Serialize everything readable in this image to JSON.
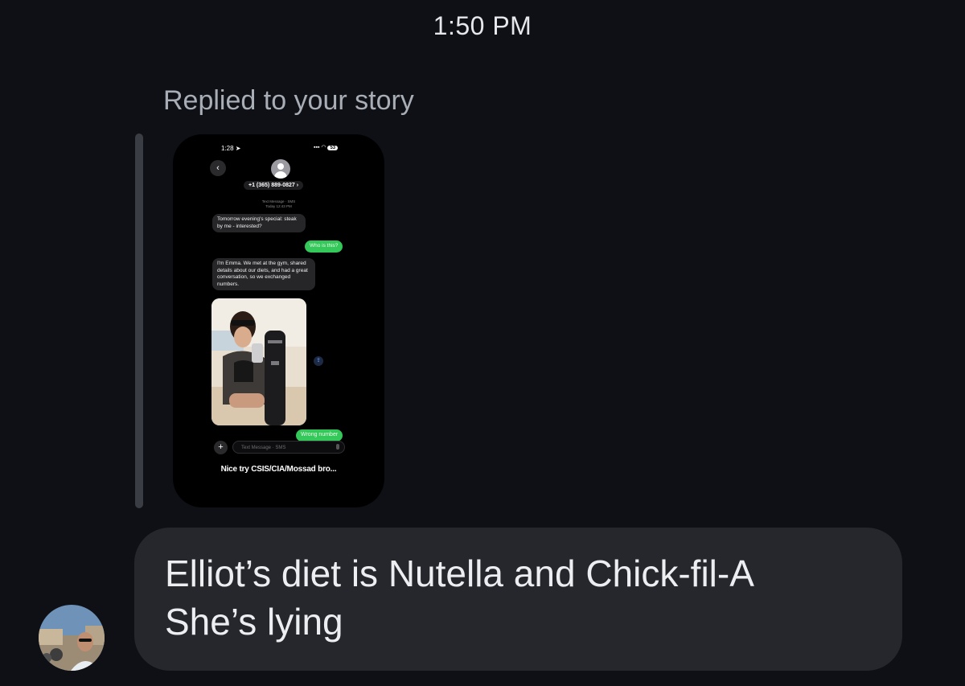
{
  "thread": {
    "timestamp": "1:50 PM",
    "reply_label": "Replied to your story"
  },
  "story": {
    "status_time": "1:28",
    "battery": "53",
    "back_glyph": "‹",
    "contact_number": "+1 (365) 889-0827 ›",
    "conversation_meta": [
      "Text Message · SMS",
      "Today 12:43 PM"
    ],
    "messages": [
      {
        "from": "them",
        "text": "Tomorrow evening's special: steak by me - interested?"
      },
      {
        "from": "me",
        "text": "Who is this?"
      },
      {
        "from": "them",
        "text": "I'm Emma. We met at the gym, shared details about our diets, and had a great conversation, so we exchanged numbers."
      },
      {
        "from": "me",
        "text": "Wrong number"
      }
    ],
    "photo": "gym mirror selfie",
    "input_placeholder": "Text Message · SMS",
    "plus_glyph": "+",
    "caption": "Nice try CSIS/CIA/Mossad bro..."
  },
  "message": {
    "lines": [
      "Elliot’s diet is Nutella and Chick-fil-A",
      "She’s lying"
    ],
    "bubble_color": "#25272c"
  },
  "sender": {
    "avatar_icon": "user-avatar-photo"
  },
  "colors": {
    "background": "#0e1015",
    "imessage_green": "#34c759",
    "reply_bar": "#3a3d44"
  }
}
